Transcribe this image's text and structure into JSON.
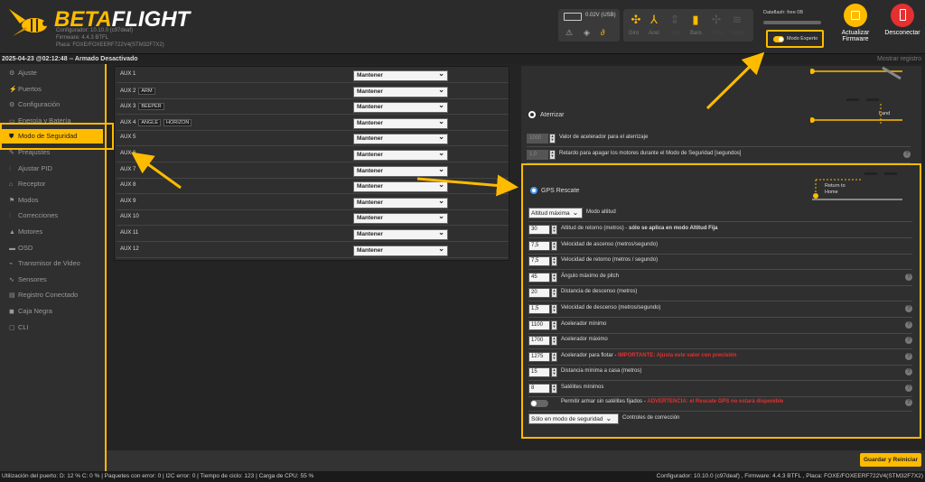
{
  "header": {
    "brand_beta": "BETA",
    "brand_flight": "FLIGHT",
    "configurator": "Configurador: 10.10.0 (c97deaf)",
    "firmware": "Firmware: 4.4.3 BTFL",
    "board": "Placa: FOXE/FOXEERF722V4(STM32F7X2)",
    "voltage": "0.02V (USB)",
    "sensors": [
      "Giro",
      "Acel",
      "Mag",
      "Baro",
      "GPS",
      "Sonar"
    ],
    "dataflash": "Dataflash: free 0B",
    "expert_mode": "Modo Experto",
    "update_firmware": "Actualizar Firmware",
    "disconnect": "Desconectar"
  },
  "statusbar": {
    "date": "2025-04-23 @02:12:48",
    "armed": "-- Armado Desactivado",
    "show_log": "Mostrar registro"
  },
  "sidebar": {
    "items": [
      {
        "label": "Ajuste",
        "icon": "wrench-icon",
        "glyph": "⚙"
      },
      {
        "label": "Puertos",
        "icon": "plug-icon",
        "glyph": "⚡"
      },
      {
        "label": "Configuración",
        "icon": "gear-icon",
        "glyph": "⚙"
      },
      {
        "label": "Energía y Batería",
        "icon": "battery-icon",
        "glyph": "▭"
      },
      {
        "label": "Modo de Seguridad",
        "icon": "shield-icon",
        "glyph": "⛊"
      },
      {
        "label": "Preajustes",
        "icon": "presets-icon",
        "glyph": "✎"
      },
      {
        "label": "Ajustar PID",
        "icon": "pid-icon",
        "glyph": "⫶"
      },
      {
        "label": "Receptor",
        "icon": "receiver-icon",
        "glyph": "⌂"
      },
      {
        "label": "Modos",
        "icon": "modes-icon",
        "glyph": "⚑"
      },
      {
        "label": "Correcciones",
        "icon": "adjustments-icon",
        "glyph": "⫶"
      },
      {
        "label": "Motores",
        "icon": "motor-icon",
        "glyph": "▲"
      },
      {
        "label": "OSD",
        "icon": "osd-icon",
        "glyph": "▬"
      },
      {
        "label": "Transmisor de Video",
        "icon": "video-icon",
        "glyph": "⌁"
      },
      {
        "label": "Sensores",
        "icon": "sensors-icon",
        "glyph": "∿"
      },
      {
        "label": "Registro Conectado",
        "icon": "log-icon",
        "glyph": "▤"
      },
      {
        "label": "Caja Negra",
        "icon": "blackbox-icon",
        "glyph": "◼"
      },
      {
        "label": "CLI",
        "icon": "cli-icon",
        "glyph": "▢"
      }
    ]
  },
  "aux": {
    "rows": [
      {
        "name": "AUX 1",
        "tags": [],
        "value": "Mantener"
      },
      {
        "name": "AUX 2",
        "tags": [
          "ARM"
        ],
        "value": "Mantener"
      },
      {
        "name": "AUX 3",
        "tags": [
          "BEEPER"
        ],
        "value": "Mantener"
      },
      {
        "name": "AUX 4",
        "tags": [
          "ANGLE",
          "HORIZON"
        ],
        "value": "Mantener"
      },
      {
        "name": "AUX 5",
        "tags": [],
        "value": "Mantener"
      },
      {
        "name": "AUX 6",
        "tags": [],
        "value": "Mantener"
      },
      {
        "name": "AUX 7",
        "tags": [],
        "value": "Mantener"
      },
      {
        "name": "AUX 8",
        "tags": [],
        "value": "Mantener"
      },
      {
        "name": "AUX 9",
        "tags": [],
        "value": "Mantener"
      },
      {
        "name": "AUX 10",
        "tags": [],
        "value": "Mantener"
      },
      {
        "name": "AUX 11",
        "tags": [],
        "value": "Mantener"
      },
      {
        "name": "AUX 12",
        "tags": [],
        "value": "Mantener"
      }
    ]
  },
  "land": {
    "label": "Aterrizar",
    "diagram_label": "Land",
    "throttle_value": "1000",
    "throttle_label": "Valor de acelerador para el aterrizaje",
    "delay_value": "1,0",
    "delay_label": "Retardo para apagar los motores durante el Modo de Seguridad [segundos]"
  },
  "gps": {
    "label": "GPS Rescate",
    "diagram_label": "Return to Home",
    "alt_mode_value": "Altitud máxima",
    "alt_mode_label": "Modo altitud",
    "rows": [
      {
        "value": "30",
        "label": "Altitud de retorno (metros) - ",
        "bold": "sólo se aplica en modo Altitud Fija",
        "warn": "",
        "help": false
      },
      {
        "value": "7,5",
        "label": "Velocidad de ascenso (metros/segundo)",
        "bold": "",
        "warn": "",
        "help": false
      },
      {
        "value": "7,5",
        "label": "Velocidad de retorno (metros / segundo)",
        "bold": "",
        "warn": "",
        "help": false
      },
      {
        "value": "45",
        "label": "Ángulo máximo de pitch",
        "bold": "",
        "warn": "",
        "help": true
      },
      {
        "value": "20",
        "label": "Distancia de descenso (metros)",
        "bold": "",
        "warn": "",
        "help": false
      },
      {
        "value": "1,5",
        "label": "Velocidad de descenso (metros/segundo)",
        "bold": "",
        "warn": "",
        "help": true
      },
      {
        "value": "1100",
        "label": "Acelerador mínimo",
        "bold": "",
        "warn": "",
        "help": true
      },
      {
        "value": "1700",
        "label": "Acelerador máximo",
        "bold": "",
        "warn": "",
        "help": true
      },
      {
        "value": "1275",
        "label": "Acelerador para flotar - ",
        "bold": "",
        "warn": "IMPORTANTE: Ajusta este valor con precisión",
        "help": true
      },
      {
        "value": "15",
        "label": "Distancia mínima a casa (metros)",
        "bold": "",
        "warn": "",
        "help": true
      },
      {
        "value": "8",
        "label": "Satélites mínimos",
        "bold": "",
        "warn": "",
        "help": true
      }
    ],
    "arm_label": "Permitir armar sin satélites fijados - ",
    "arm_warn": "ADVERTENCIA: el Rescate GPS no estará disponible",
    "sanity_value": "Sólo en modo de seguridad",
    "sanity_label": "Controles de corrección"
  },
  "footer": {
    "save": "Guardar y Reiniciar"
  },
  "bottom": {
    "left": "Utilización del puerto: D: 12 % C: 0 %  |  Paquetes con error: 0  |  I2C error: 0  |  Tiempo de ciclo: 123  |  Carga de CPU: 55 %",
    "right": "Configurador: 10.10.0 (c97deaf) , Firmware: 4.4.3 BTFL , Placa: FOXE/FOXEERF722V4(STM32F7X2)"
  },
  "colors": {
    "accent": "#ffbb00",
    "warn": "#e53030",
    "radio": "#4a9eff"
  }
}
